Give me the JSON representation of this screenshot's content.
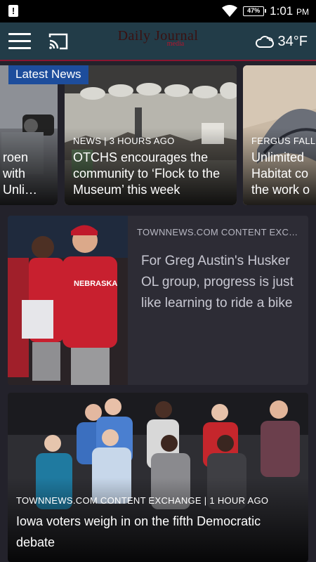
{
  "status_bar": {
    "battery": "47%",
    "time": "1:01",
    "ampm": "PM"
  },
  "app_bar": {
    "logo_main": "Daily Journal",
    "logo_sub": "media",
    "temperature": "34°F",
    "icons": [
      "hamburger-menu-icon",
      "cast-icon",
      "cloud-weather-icon"
    ]
  },
  "carousel": {
    "badge": "Latest News",
    "cards": [
      {
        "meta": "",
        "title": "roen\nwith\nUnli…"
      },
      {
        "meta": "NEWS | 3 HOURS AGO",
        "title": "OTCHS encourages the community to ‘Flock to the Museum’ this week"
      },
      {
        "meta": "FERGUS FALL",
        "title": "Unlimited\nHabitat co\nthe work o"
      }
    ]
  },
  "stories": [
    {
      "meta": "TOWNNEWS.COM CONTENT EXC…",
      "title": "For Greg Austin's Husker OL group, progress is just like learning to ride a bike"
    },
    {
      "meta": "TOWNNEWS.COM CONTENT EXCHANGE | 1 HOUR AGO",
      "title": "Iowa voters weigh in on the fifth Democratic debate"
    }
  ],
  "colors": {
    "status_bg": "#000000",
    "app_bar_bg": "#223c48",
    "accent_red": "#8a1530",
    "badge_blue": "#1d4d9c",
    "page_bg": "#23222b"
  }
}
